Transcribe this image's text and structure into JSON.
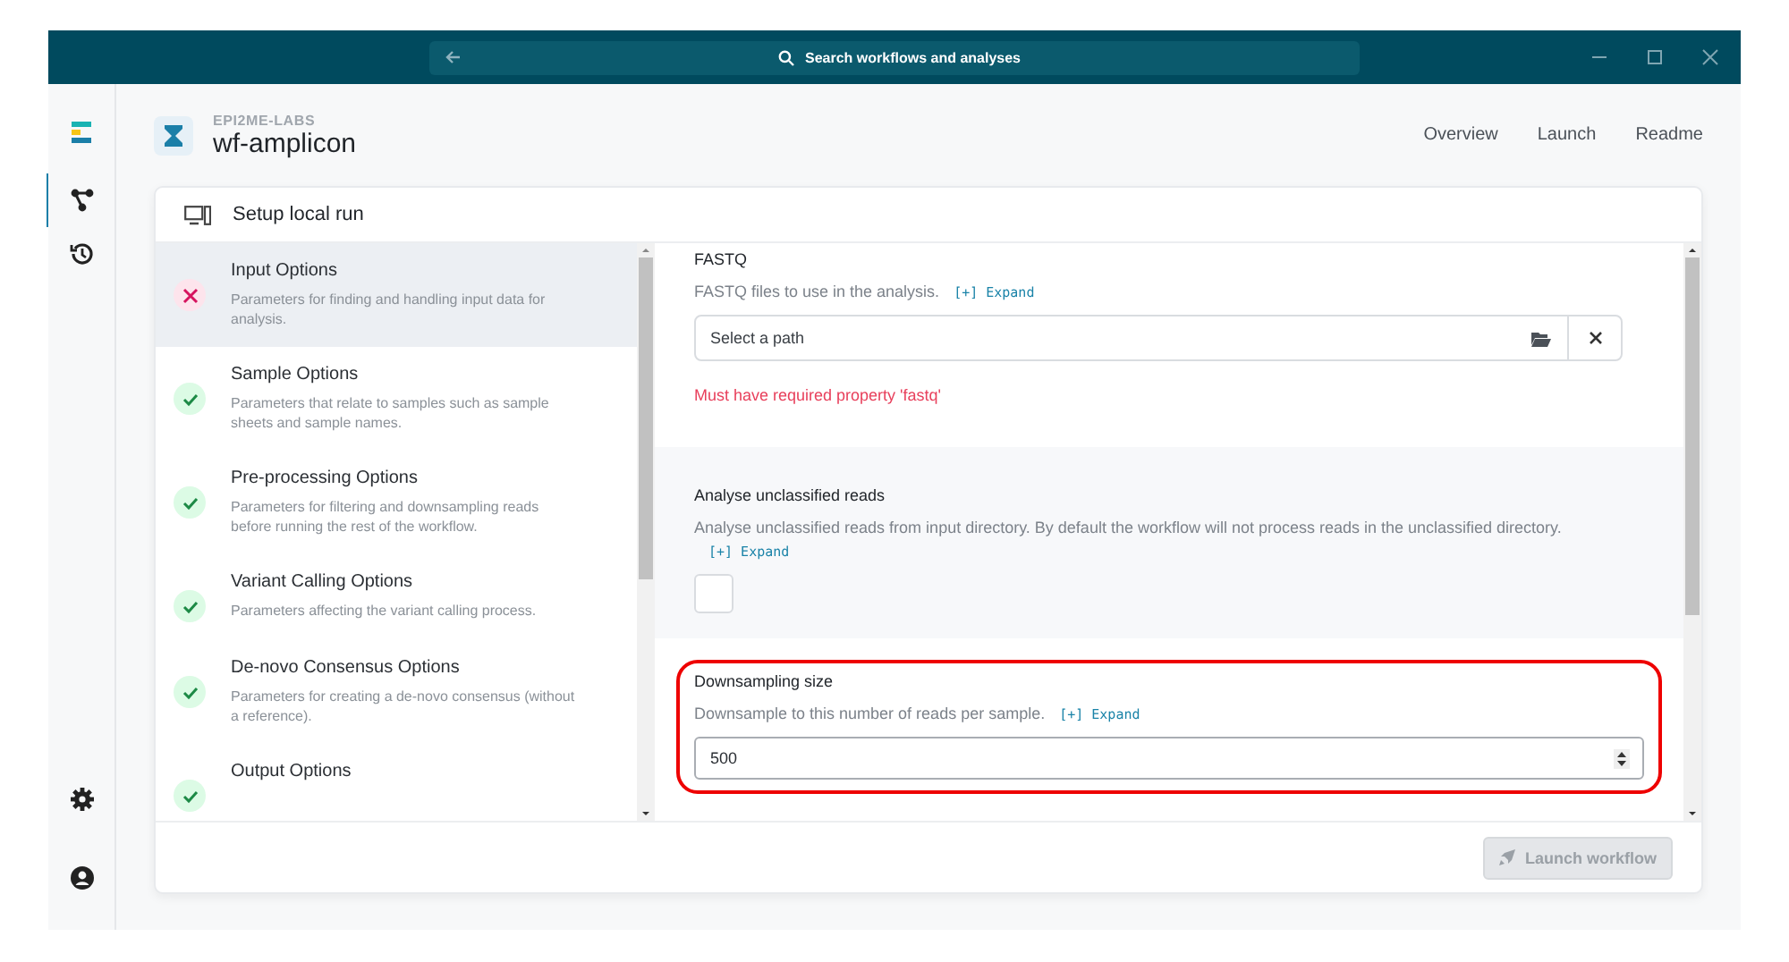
{
  "search": {
    "placeholder": "Search workflows and analyses"
  },
  "workflow": {
    "org": "EPI2ME-LABS",
    "name": "wf-amplicon"
  },
  "nav": [
    {
      "label": "Overview"
    },
    {
      "label": "Launch"
    },
    {
      "label": "Readme"
    }
  ],
  "card": {
    "title": "Setup local run"
  },
  "steps": [
    {
      "title": "Input Options",
      "description": "Parameters for finding and handling input data for analysis.",
      "valid": false,
      "selected": true
    },
    {
      "title": "Sample Options",
      "description": "Parameters that relate to samples such as sample sheets and sample names.",
      "valid": true,
      "selected": false
    },
    {
      "title": "Pre-processing Options",
      "description": "Parameters for filtering and downsampling reads before running the rest of the workflow.",
      "valid": true,
      "selected": false
    },
    {
      "title": "Variant Calling Options",
      "description": "Parameters affecting the variant calling process.",
      "valid": true,
      "selected": false
    },
    {
      "title": "De-novo Consensus Options",
      "description": "Parameters for creating a de-novo consensus (without a reference).",
      "valid": true,
      "selected": false
    },
    {
      "title": "Output Options",
      "valid": true,
      "selected": false
    }
  ],
  "fields": [
    {
      "kind": "path",
      "label": "FASTQ",
      "description": "FASTQ files to use in the analysis.",
      "expand": "[+] Expand",
      "placeholder": "Select a path",
      "error": "Must have required property 'fastq'"
    },
    {
      "kind": "checkbox",
      "label": "Analyse unclassified reads",
      "description": "Analyse unclassified reads from input directory. By default the workflow will not process reads in the unclassified directory.",
      "expand": "[+] Expand",
      "checked": false
    },
    {
      "kind": "number",
      "label": "Downsampling size",
      "description": "Downsample to this number of reads per sample.",
      "expand": "[+] Expand",
      "value": "500",
      "highlighted": true
    }
  ],
  "launch": {
    "label": "Launch workflow",
    "disabled": true
  }
}
